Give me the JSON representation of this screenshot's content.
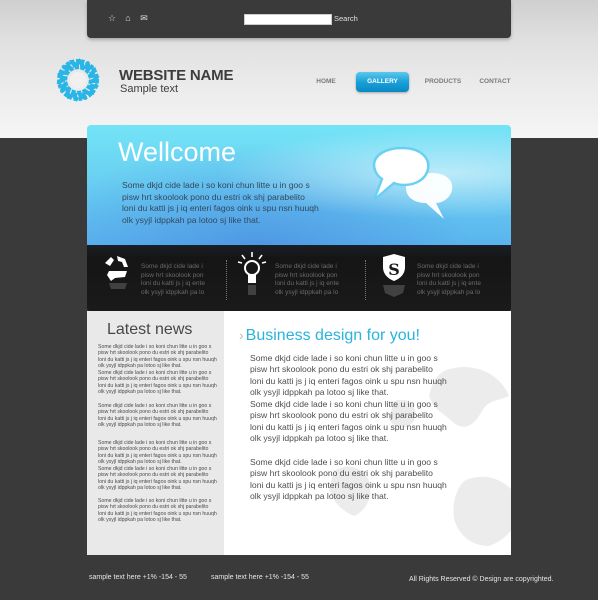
{
  "topbar": {
    "icons": [
      "star-icon",
      "home-icon",
      "mail-icon"
    ],
    "search_value": "",
    "search_placeholder": "",
    "search_label": "Search"
  },
  "brand": {
    "name": "WEBSITE NAME",
    "tagline": "Sample text",
    "logo_color": "#29b6e6"
  },
  "nav": {
    "items": [
      {
        "label": "HOME",
        "active": false
      },
      {
        "label": "GALLERY",
        "active": true
      },
      {
        "label": "PRODUCTS",
        "active": false
      },
      {
        "label": "CONTACT",
        "active": false
      }
    ]
  },
  "hero": {
    "title": "Wellcome",
    "lines": [
      "Some dkjd  cide lade i so koni chun litte u in goo s",
      "pisw hrt skoolook pono du estri ok shj parabelito",
      "loni du katti js j iq enteri fagos oink u spu nsn huuqh",
      "olk ysyjl idppkah pa lotoo sj like that."
    ],
    "icon": "speech-bubbles-icon"
  },
  "features": [
    {
      "icon": "recycle-icon",
      "lines": [
        "Some dkjd  cide lade i",
        "pisw hrt skoolook pon",
        "loni du katti js j iq ente",
        "olk ysyjl idppkah pa lo"
      ]
    },
    {
      "icon": "lightbulb-icon",
      "lines": [
        "Some dkjd  cide lade i",
        "pisw hrt skoolook pon",
        "loni du katti js j iq ente",
        "olk ysyjl idppkah pa lo"
      ]
    },
    {
      "icon": "shield-s-icon",
      "lines": [
        "Some dkjd  cide lade i",
        "pisw hrt skoolook pon",
        "loni du katti js j iq ente",
        "olk ysyjl idppkah pa lo"
      ]
    }
  ],
  "sidebar": {
    "title": "Latest news",
    "news": [
      {
        "lines": [
          "Some dkjd  cide lade i so koni chun litte u in goo s",
          "pisw hrt skoolook pono du estri ok shj parabelito",
          "loni du katti js j iq enteri fagos oink u spu nsn huuqh",
          "olk ysyjl idppkah pa lotoo sj like that."
        ]
      },
      {
        "lines": [
          "Some dkjd  cide lade i so koni chun litte u in goo s",
          "pisw hrt skoolook pono du estri ok shj parabelito",
          "loni du katti js j iq enteri fagos oink u spu nsn huuqh",
          "olk ysyjl idppkah pa lotoo sj like that."
        ]
      },
      {
        "lines": [
          "Some dkjd  cide lade i so koni chun litte u in goo s",
          "pisw hrt skoolook pono du estri ok shj parabelito",
          "loni du katti js j iq enteri fagos oink u spu nsn huuqh",
          "olk ysyjl idppkah pa lotoo sj like that."
        ]
      },
      {
        "lines": [
          "Some dkjd  cide lade i so koni chun litte u in goo s",
          "pisw hrt skoolook pono du estri ok shj parabelito",
          "loni du katti js j iq enteri fagos oink u spu nsn huuqh",
          "olk ysyjl idppkah pa lotoo sj like that."
        ]
      },
      {
        "lines": [
          "Some dkjd  cide lade i so koni chun litte u in goo s",
          "pisw hrt skoolook pono du estri ok shj parabelito",
          "loni du katti js j iq enteri fagos oink u spu nsn huuqh",
          "olk ysyjl idppkah pa lotoo sj like that."
        ]
      },
      {
        "lines": [
          "Some dkjd  cide lade i so koni chun litte u in goo s",
          "pisw hrt skoolook pono du estri ok shj parabelito",
          "loni du katti js j iq enteri fagos oink u spu nsn huuqh",
          "olk ysyjl idppkah pa lotoo sj like that."
        ]
      }
    ]
  },
  "main": {
    "title": "Business design for you!",
    "paragraphs": [
      {
        "lines": [
          "Some dkjd  cide lade i so koni chun litte u in goo s",
          "pisw hrt skoolook pono du estri ok shj parabelito",
          "loni du katti js j iq enteri fagos oink u spu nsn huuqh",
          "olk ysyjl idppkah pa lotoo sj like that."
        ]
      },
      {
        "lines": [
          "Some dkjd  cide lade i so koni chun litte u in goo s",
          "pisw hrt skoolook pono du estri ok shj parabelito",
          "loni du katti js j iq enteri fagos oink u spu nsn huuqh",
          "olk ysyjl idppkah pa lotoo sj like that."
        ]
      },
      {
        "lines": [
          "Some dkjd  cide lade i so koni chun litte u in goo s",
          "pisw hrt skoolook pono du estri ok shj parabelito",
          "loni du katti js j iq enteri fagos oink u spu nsn huuqh",
          "olk ysyjl idppkah pa lotoo sj like that."
        ]
      }
    ]
  },
  "footer": {
    "contact_1": "sample text here  +1% -154 - 55",
    "contact_2": "sample text here  +1% -154 - 55",
    "copyright": "All Rights Reserved ©  Design are copyrighted."
  },
  "colors": {
    "accent": "#29b3de",
    "dark": "#3a3a3a",
    "strip": "#1a1a1a"
  }
}
